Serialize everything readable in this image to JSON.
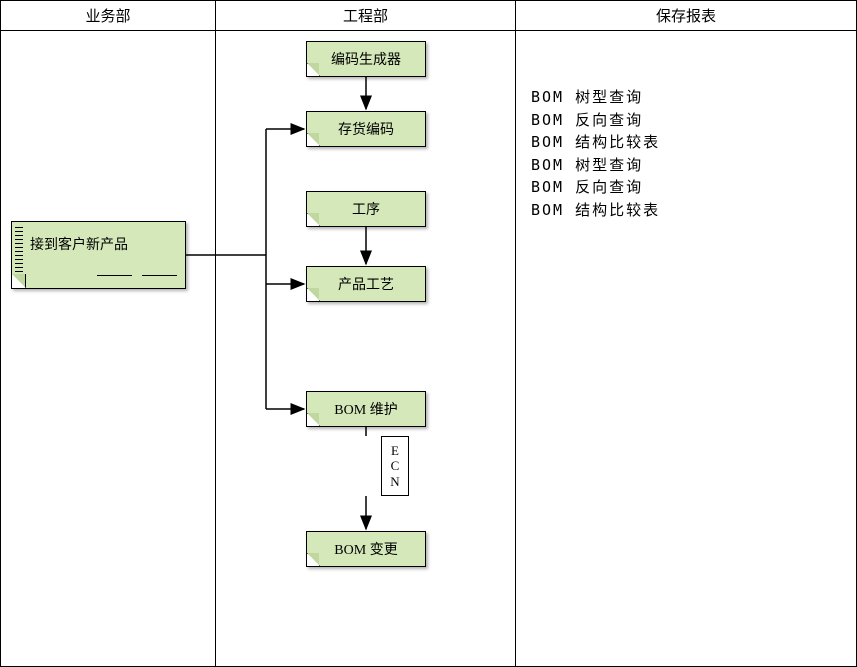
{
  "columns": {
    "col1": "业务部",
    "col2": "工程部",
    "col3": "保存报表"
  },
  "start": {
    "label": "接到客户新产品"
  },
  "blocks": {
    "codegen": "编码生成器",
    "inventory": "存货编码",
    "procedure": "工序",
    "product_process": "产品工艺",
    "bom_maintain": "BOM 维护",
    "bom_change": "BOM 变更"
  },
  "ecn": {
    "l1": "E",
    "l2": "C",
    "l3": "N"
  },
  "reports": {
    "r1": "BOM 树型查询",
    "r2": "BOM 反向查询",
    "r3": "BOM 结构比较表",
    "r4": "BOM 树型查询",
    "r5": "BOM 反向查询",
    "r6": "BOM 结构比较表"
  }
}
